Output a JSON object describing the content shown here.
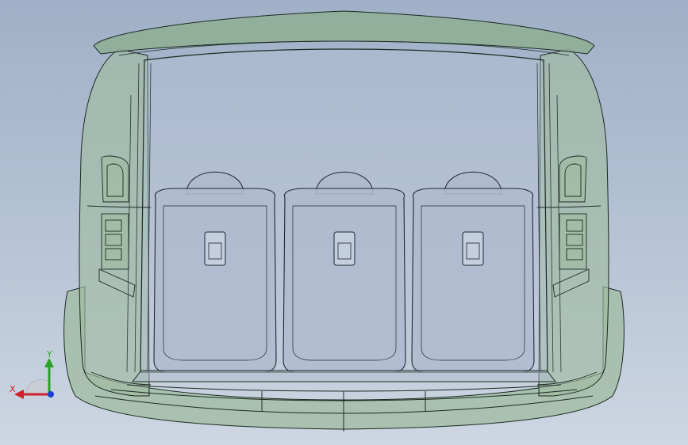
{
  "scene": {
    "background_top": "#9fb0c7",
    "background_bottom": "#cdd6e2",
    "body_fill": "#9fbba2",
    "body_edge": "#1c2a20",
    "glass_fill": "#b8c4d6",
    "seat_fill": "#aebbcf",
    "seat_edge": "#22262e",
    "rear_seats": [
      {
        "name": "left-seatback"
      },
      {
        "name": "center-seatback"
      },
      {
        "name": "right-seatback"
      }
    ]
  },
  "triad": {
    "x_label": "X",
    "y_label": "Y",
    "x_color": "#d0202a",
    "y_color": "#2aa02a",
    "z_color": "#1a3fd0",
    "x_icon": "x-axis-arrow-icon",
    "y_icon": "y-axis-arrow-icon",
    "z_icon": "z-axis-dot-icon"
  }
}
